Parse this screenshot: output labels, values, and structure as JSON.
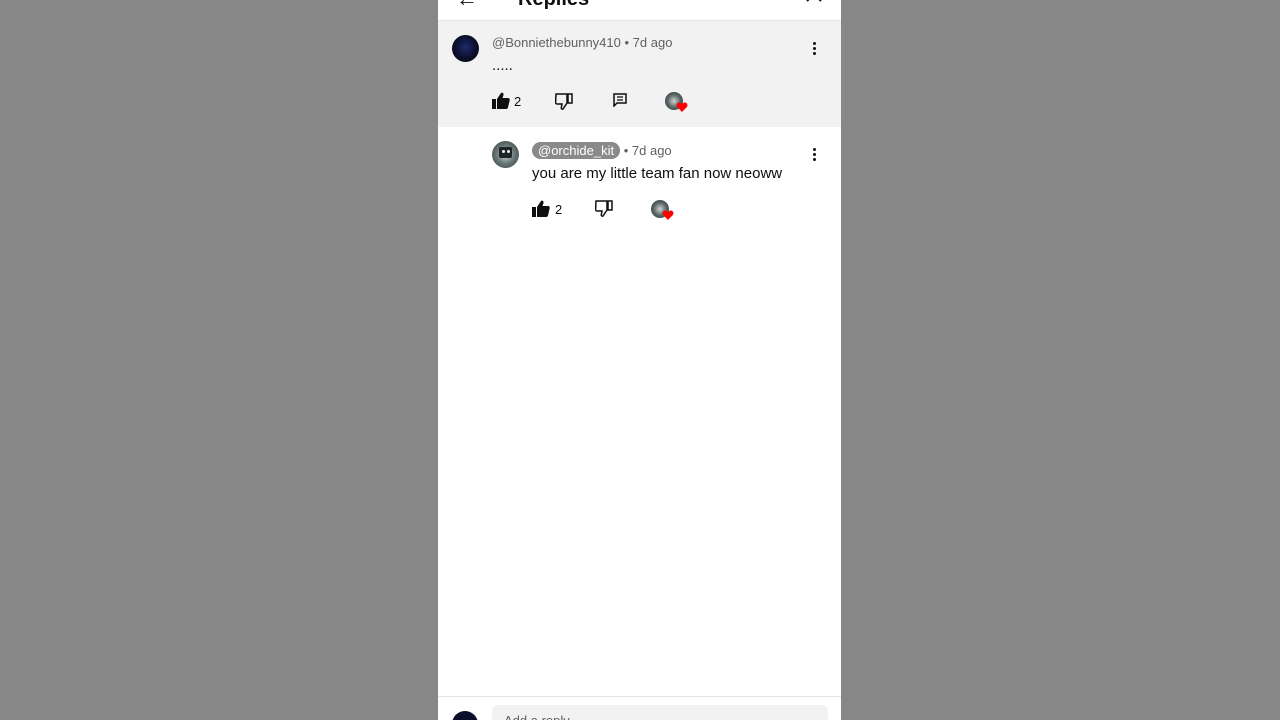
{
  "header": {
    "back_icon": "arrow-left-icon",
    "title": "Replies",
    "close_icon": "close-icon"
  },
  "parent_comment": {
    "author": "@Bonniethebunny410",
    "age": "7d ago",
    "separator": "•",
    "text": ".....",
    "likes": "2",
    "icons": [
      "thumb-up-icon",
      "thumb-down-icon",
      "reply-icon",
      "creator-heart-icon",
      "more-vert-icon"
    ]
  },
  "reply": {
    "author": "@orchide_kit",
    "age": "7d ago",
    "separator": "•",
    "text": "you are my little team fan now neoww",
    "likes": "2",
    "icons": [
      "thumb-up-icon",
      "thumb-down-icon",
      "creator-heart-icon",
      "more-vert-icon"
    ]
  },
  "bottom": {
    "placeholder": "Add a reply..."
  },
  "colors": {
    "backdrop": "#878787",
    "panel": "#ffffff",
    "highlight": "#f2f2f2",
    "heart": "#ff0000",
    "pill": "#8a8a8a"
  }
}
